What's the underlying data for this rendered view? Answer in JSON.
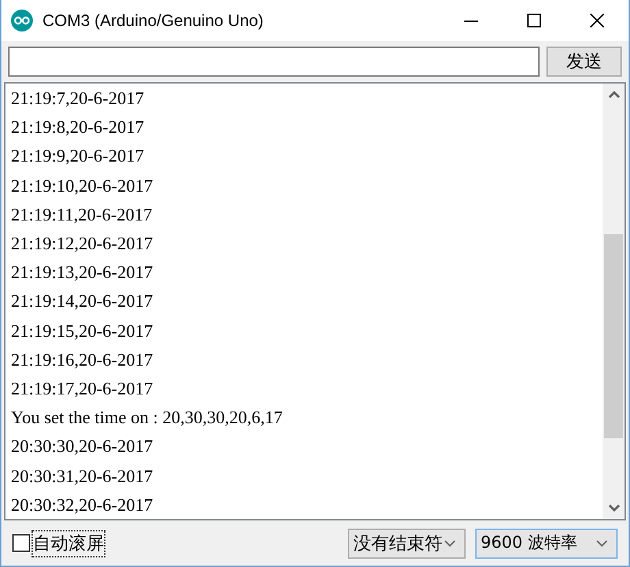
{
  "window": {
    "title": "COM3 (Arduino/Genuino Uno)"
  },
  "send_button": "发送",
  "output_lines": [
    "21:19:7,20-6-2017",
    "21:19:8,20-6-2017",
    "21:19:9,20-6-2017",
    "21:19:10,20-6-2017",
    "21:19:11,20-6-2017",
    "21:19:12,20-6-2017",
    "21:19:13,20-6-2017",
    "21:19:14,20-6-2017",
    "21:19:15,20-6-2017",
    "21:19:16,20-6-2017",
    "21:19:17,20-6-2017",
    "You set the time on : 20,30,30,20,6,17",
    "20:30:30,20-6-2017",
    "20:30:31,20-6-2017",
    "20:30:32,20-6-2017"
  ],
  "autoscroll": {
    "label": "自动滚屏",
    "checked": false
  },
  "line_ending": "没有结束符",
  "baud_rate": "9600 波特率"
}
